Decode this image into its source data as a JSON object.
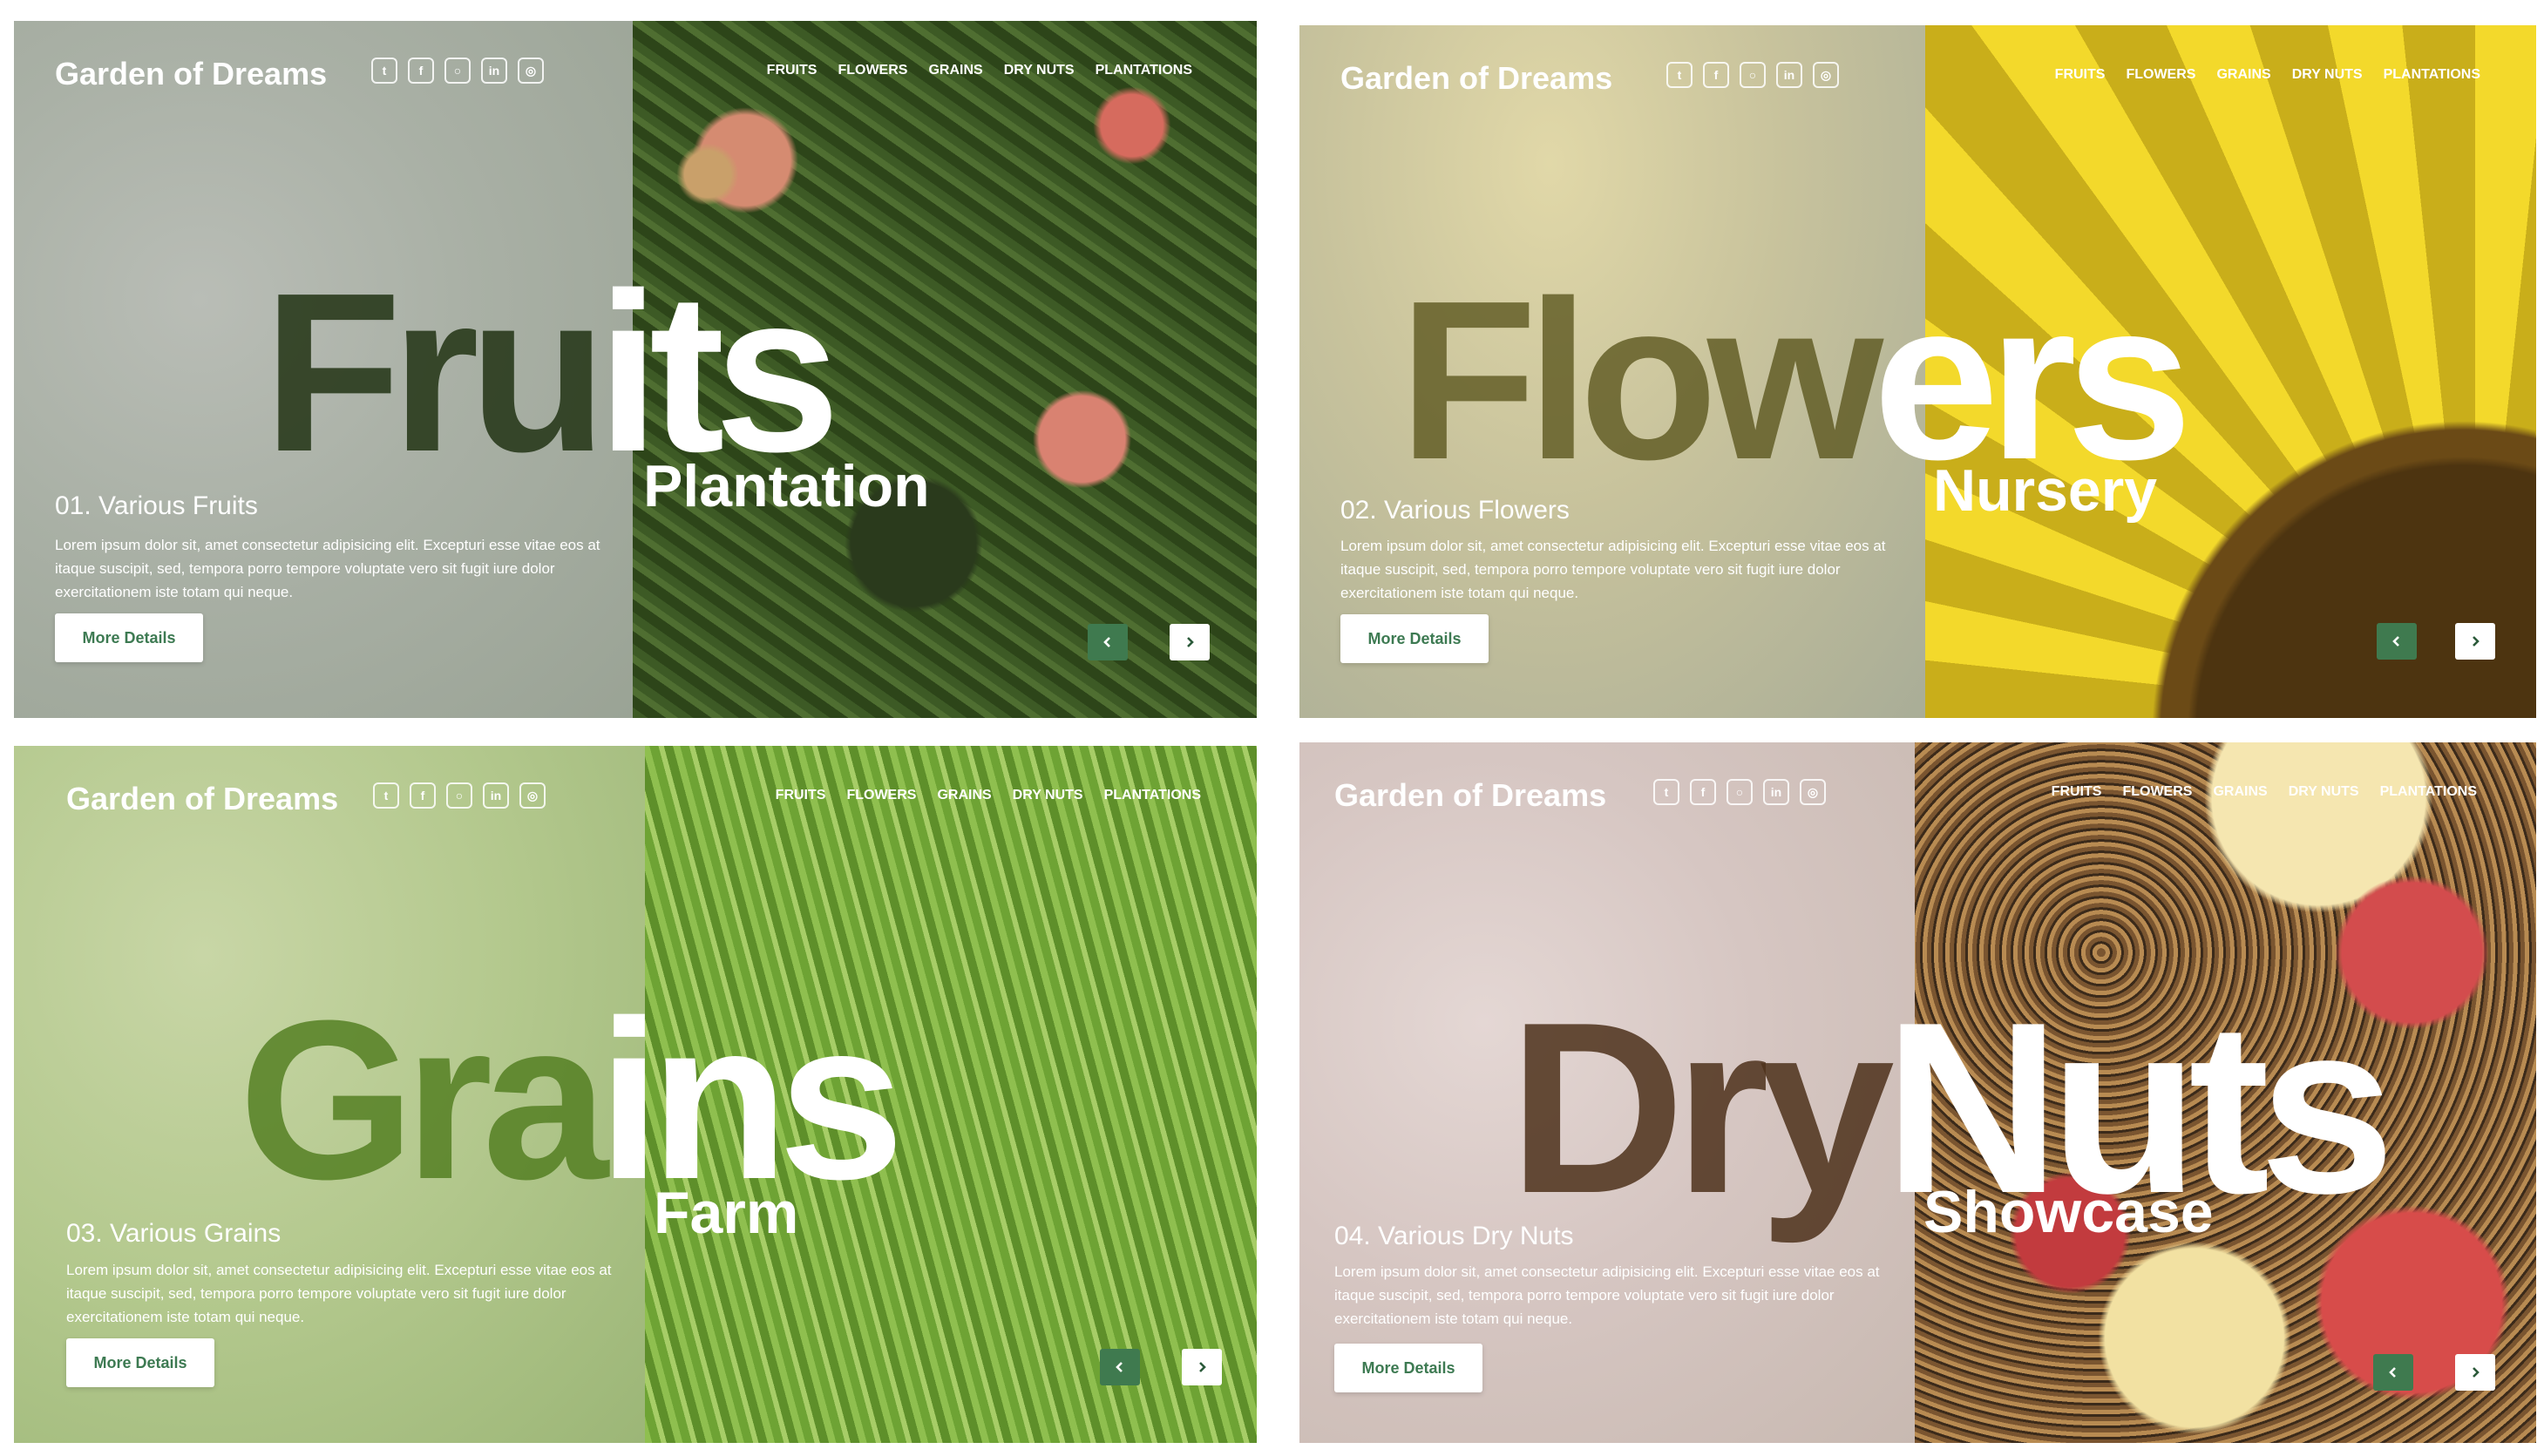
{
  "brand": "Garden of Dreams",
  "nav": [
    "FRUITS",
    "FLOWERS",
    "GRAINS",
    "DRY NUTS",
    "PLANTATIONS"
  ],
  "socials": [
    {
      "icon": "twitter-icon",
      "glyph": "t"
    },
    {
      "icon": "facebook-icon",
      "glyph": "f"
    },
    {
      "icon": "github-icon",
      "glyph": "○"
    },
    {
      "icon": "linkedin-icon",
      "glyph": "in"
    },
    {
      "icon": "instagram-icon",
      "glyph": "◎"
    }
  ],
  "button_label": "More Details",
  "description": "Lorem ipsum dolor sit, amet consectetur adipisicing elit. Excepturi esse vitae eos at itaque suscipit, sed, tempora porro tempore voluptate vero sit fugit iure dolor exercitationem iste totam qui neque.",
  "colors": {
    "accent_green": "#3f7a4f",
    "button_text": "#3d7a52"
  },
  "slides": [
    {
      "headline_left": "Fru",
      "headline_right": "its",
      "subtitle": "Plantation",
      "title": "01. Various Fruits"
    },
    {
      "headline_left": "Flow",
      "headline_right": "ers",
      "subtitle": "Nursery",
      "title": "02. Various Flowers"
    },
    {
      "headline_left": "Gra",
      "headline_right": "ins",
      "subtitle": "Farm",
      "title": "03. Various Grains"
    },
    {
      "headline_left": "Dry",
      "headline_right": "Nuts",
      "subtitle": "Showcase",
      "title": "04. Various Dry Nuts"
    }
  ]
}
